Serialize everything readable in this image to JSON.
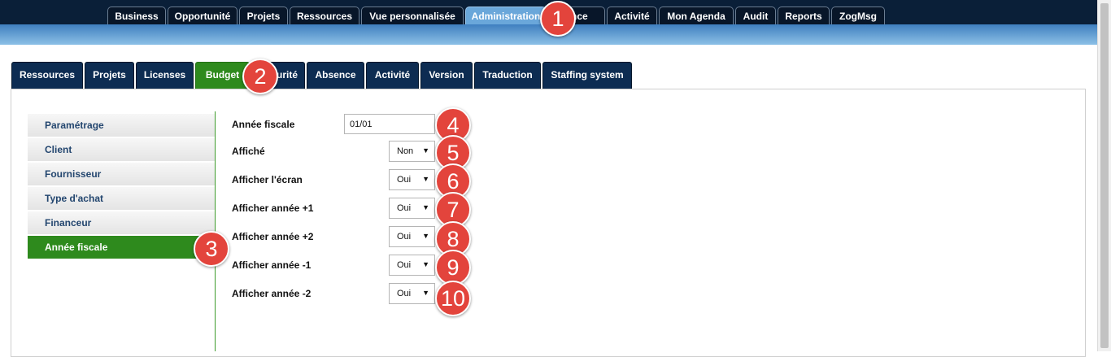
{
  "top_nav": {
    "tabs": [
      {
        "label": "Business"
      },
      {
        "label": "Opportunité"
      },
      {
        "label": "Projets"
      },
      {
        "label": "Ressources"
      },
      {
        "label": "Vue personnalisée"
      },
      {
        "label": "Administration",
        "active": true
      },
      {
        "label": "ence"
      },
      {
        "label": "Activité"
      },
      {
        "label": "Mon Agenda"
      },
      {
        "label": "Audit"
      },
      {
        "label": "Reports"
      },
      {
        "label": "ZogMsg"
      }
    ]
  },
  "admin_tabs": {
    "tabs": [
      {
        "label": "Ressources"
      },
      {
        "label": "Projets"
      },
      {
        "label": "Licenses"
      },
      {
        "label": "Budget",
        "active": true
      },
      {
        "label": "urité"
      },
      {
        "label": "Absence"
      },
      {
        "label": "Activité"
      },
      {
        "label": "Version"
      },
      {
        "label": "Traduction"
      },
      {
        "label": "Staffing system"
      }
    ]
  },
  "side_menu": {
    "items": [
      {
        "label": "Paramétrage"
      },
      {
        "label": "Client"
      },
      {
        "label": "Fournisseur"
      },
      {
        "label": "Type d'achat"
      },
      {
        "label": "Financeur"
      },
      {
        "label": "Année fiscale",
        "active": true
      }
    ]
  },
  "form": {
    "fiscal_year": {
      "label": "Année fiscale",
      "value": "01/01"
    },
    "selects": [
      {
        "label": "Affiché",
        "value": "Non"
      },
      {
        "label": "Afficher l'écran",
        "value": "Oui"
      },
      {
        "label": "Afficher année +1",
        "value": "Oui"
      },
      {
        "label": "Afficher année +2",
        "value": "Oui"
      },
      {
        "label": "Afficher année -1",
        "value": "Oui"
      },
      {
        "label": "Afficher année -2",
        "value": "Oui"
      }
    ],
    "dropdown_arrow": "▼"
  },
  "callouts": [
    "1",
    "2",
    "3",
    "4",
    "5",
    "6",
    "7",
    "8",
    "9",
    "10"
  ],
  "colors": {
    "header_dark": "#0a1f38",
    "tab_navy": "#0d2c52",
    "active_green": "#2e8a1d",
    "menu_text": "#23466f",
    "callout_red": "#e3443c"
  }
}
